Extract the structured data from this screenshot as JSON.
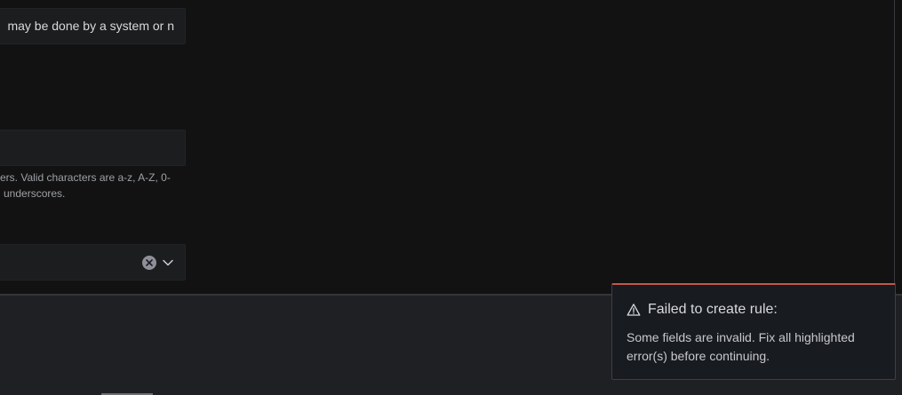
{
  "form": {
    "description_value": "may be done by a system or n",
    "name_value": "",
    "help_line1": "ers. Valid characters are a-z, A-Z, 0-",
    "help_line2": "underscores.",
    "select_value": ""
  },
  "icons": {
    "clear": "clear-icon",
    "chevron": "chevron-down-icon",
    "warning": "warning-icon"
  },
  "toast": {
    "title": "Failed to create rule:",
    "message": "Some fields are invalid. Fix all highlighted error(s) before continuing.",
    "accent_color": "#c4574b"
  }
}
